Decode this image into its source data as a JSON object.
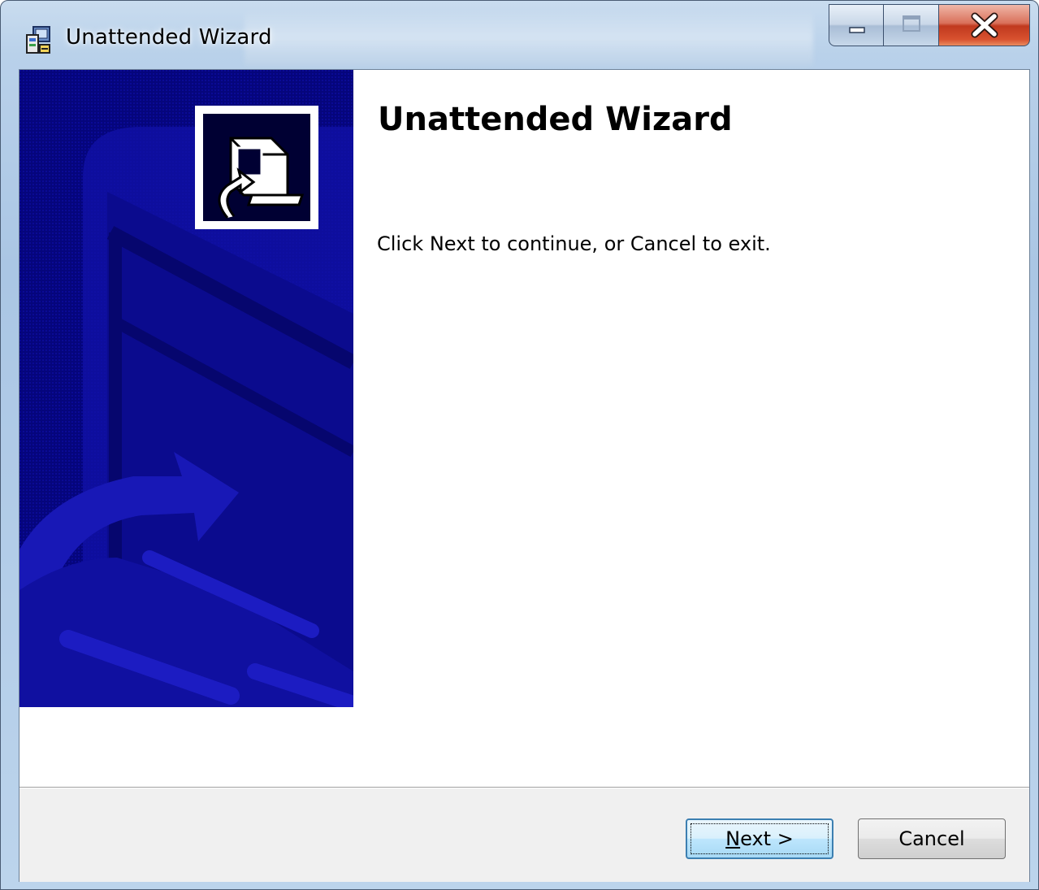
{
  "window": {
    "title": "Unattended Wizard",
    "icon": "installer-package-icon",
    "caption_buttons": [
      "minimize-icon",
      "maximize-icon",
      "close-icon"
    ]
  },
  "side_panel": {
    "background_color": "#05057c",
    "hero_icon": "computer-setup-icon"
  },
  "content": {
    "heading": "Unattended Wizard",
    "instruction": "Click Next to continue, or Cancel to exit."
  },
  "footer": {
    "next_button": {
      "mnemonic": "N",
      "rest": "ext >"
    },
    "cancel_button": {
      "label": "Cancel"
    }
  }
}
